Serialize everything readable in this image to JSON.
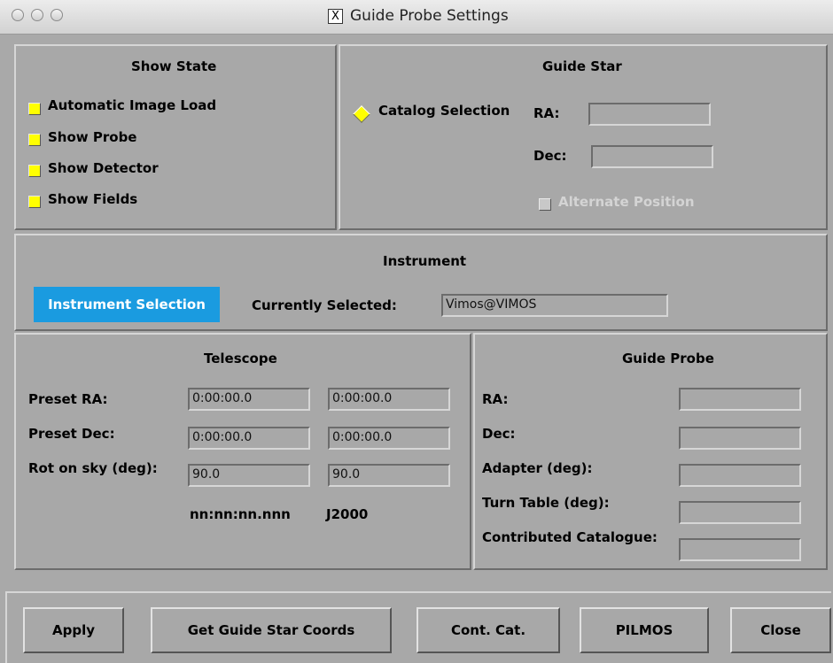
{
  "window": {
    "title": "Guide Probe Settings",
    "title_glyph": "X"
  },
  "show_state": {
    "heading": "Show State",
    "items": [
      {
        "label": "Automatic Image Load",
        "checked": true
      },
      {
        "label": "Show Probe",
        "checked": true
      },
      {
        "label": "Show Detector",
        "checked": true
      },
      {
        "label": "Show Fields",
        "checked": true
      }
    ]
  },
  "guide_star": {
    "heading": "Guide Star",
    "catalog_selection": "Catalog Selection",
    "ra_label": "RA:",
    "ra_value": "",
    "dec_label": "Dec:",
    "dec_value": "",
    "alternate_position": "Alternate Position"
  },
  "instrument": {
    "heading": "Instrument",
    "selection_button": "Instrument Selection",
    "currently_selected_label": "Currently Selected:",
    "currently_selected_value": "Vimos@VIMOS"
  },
  "telescope": {
    "heading": "Telescope",
    "rows": [
      {
        "label": "Preset RA:",
        "value1": "0:00:00.0",
        "value2": "0:00:00.0"
      },
      {
        "label": "Preset Dec:",
        "value1": "0:00:00.0",
        "value2": "0:00:00.0"
      },
      {
        "label": "Rot on sky (deg):",
        "value1": "90.0",
        "value2": "90.0"
      }
    ],
    "format_hint": "nn:nn:nn.nnn",
    "epoch": "J2000"
  },
  "guide_probe": {
    "heading": "Guide Probe",
    "rows": [
      {
        "label": "RA:",
        "value": ""
      },
      {
        "label": "Dec:",
        "value": ""
      },
      {
        "label": "Adapter (deg):",
        "value": ""
      },
      {
        "label": "Turn Table (deg):",
        "value": ""
      },
      {
        "label": "Contributed Catalogue:",
        "value": ""
      }
    ]
  },
  "buttons": {
    "apply": "Apply",
    "get_coords": "Get Guide Star Coords",
    "cont_cat": "Cont. Cat.",
    "pilmos": "PILMOS",
    "close": "Close"
  },
  "colors": {
    "accent": "#1a9be0",
    "checkbox": "#ffff00",
    "background": "#a8a8a8"
  }
}
